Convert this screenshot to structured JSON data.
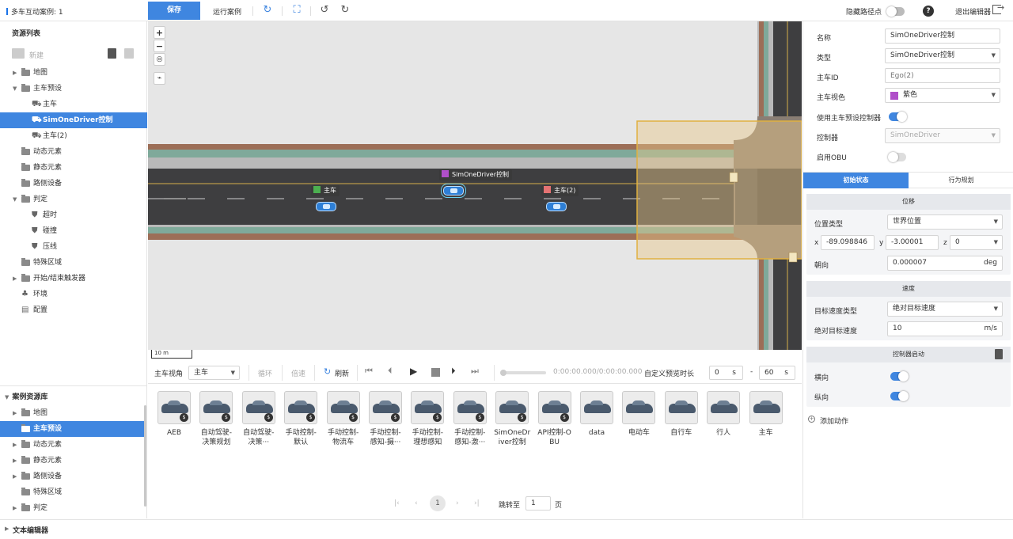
{
  "toolbar": {
    "case_title": "多车互动案例: 1",
    "save_label": "保存",
    "run_label": "运行案例",
    "hide_waypoints_label": "隐藏路径点",
    "help_label": "?",
    "exit_label": "退出编辑器"
  },
  "resources": {
    "title": "资源列表",
    "new_label": "新建",
    "items": [
      {
        "label": "地图"
      },
      {
        "label": "主车预设"
      },
      {
        "label": "主车"
      },
      {
        "label": "SimOneDriver控制"
      },
      {
        "label": "主车(2)"
      },
      {
        "label": "动态元素"
      },
      {
        "label": "静态元素"
      },
      {
        "label": "路侧设备"
      },
      {
        "label": "判定"
      },
      {
        "label": "超时"
      },
      {
        "label": "碰撞"
      },
      {
        "label": "压线"
      },
      {
        "label": "特殊区域"
      },
      {
        "label": "开始/结束触发器"
      },
      {
        "label": "环境"
      },
      {
        "label": "配置"
      }
    ]
  },
  "case_library": {
    "title": "案例资源库",
    "items": [
      {
        "label": "地图"
      },
      {
        "label": "主车预设"
      },
      {
        "label": "动态元素"
      },
      {
        "label": "静态元素"
      },
      {
        "label": "路侧设备"
      },
      {
        "label": "特殊区域"
      },
      {
        "label": "判定"
      }
    ]
  },
  "map": {
    "scale_label": "10 m",
    "vehicles": [
      {
        "label": "主车",
        "color": "#4caf50"
      },
      {
        "label": "SimOneDriver控制",
        "color": "#b04fc9"
      },
      {
        "label": "主车(2)",
        "color": "#e57373"
      }
    ]
  },
  "controls": {
    "view_label": "主车视角",
    "view_value": "主车",
    "loop_label": "循环",
    "speed_label": "倍速",
    "refresh_label": "刷新",
    "time_display": "0:00:00.000/0:00:00.000",
    "preview_label": "自定义预览时长",
    "preview_start": "0",
    "preview_end": "60",
    "unit_s": "s",
    "dash": "-",
    "progress": 0
  },
  "assets": [
    {
      "name": "AEB"
    },
    {
      "name": "自动驾驶-决策规划"
    },
    {
      "name": "自动驾驶-决策···"
    },
    {
      "name": "手动控制-默认"
    },
    {
      "name": "手动控制-物流车"
    },
    {
      "name": "手动控制-感知-摄···"
    },
    {
      "name": "手动控制-理想感知"
    },
    {
      "name": "手动控制-感知-激···"
    },
    {
      "name": "SimOneDriver控制"
    },
    {
      "name": "API控制-OBU"
    },
    {
      "name": "data"
    },
    {
      "name": "电动车"
    },
    {
      "name": "自行车"
    },
    {
      "name": "行人"
    },
    {
      "name": "主车"
    }
  ],
  "pagination": {
    "current": "1",
    "goto_label": "跳转至",
    "goto_value": "1",
    "page_unit": "页"
  },
  "properties": {
    "name_label": "名称",
    "name_value": "SimOneDriver控制",
    "type_label": "类型",
    "type_value": "SimOneDriver控制",
    "ego_id_label": "主车ID",
    "ego_id_placeholder": "Ego(2)",
    "color_label": "主车视色",
    "color_value": "紫色",
    "color_hex": "#b04fc9",
    "use_preset_label": "使用主车预设控制器",
    "use_preset_on": true,
    "controller_label": "控制器",
    "controller_value": "SimOneDriver",
    "obu_label": "启用OBU",
    "obu_on": false
  },
  "tabs": [
    {
      "label": "初始状态",
      "active": true
    },
    {
      "label": "行为规划",
      "active": false
    }
  ],
  "position": {
    "title": "位移",
    "pos_type_label": "位置类型",
    "pos_type_value": "世界位置",
    "x_label": "x",
    "x_value": "-89.098846",
    "y_label": "y",
    "y_value": "-3.00001",
    "z_label": "z",
    "z_value": "0",
    "heading_label": "朝向",
    "heading_value": "0.000007",
    "heading_unit": "deg"
  },
  "speed": {
    "title": "速度",
    "type_label": "目标速度类型",
    "type_value": "绝对目标速度",
    "abs_label": "绝对目标速度",
    "abs_value": "10",
    "abs_unit": "m/s"
  },
  "controller_start": {
    "title": "控制器启动",
    "lateral_label": "横向",
    "lateral_on": true,
    "longitudinal_label": "纵向",
    "longitudinal_on": true
  },
  "add_action_label": "添加动作",
  "status_bar": {
    "text_editor_label": "文本编辑器"
  }
}
